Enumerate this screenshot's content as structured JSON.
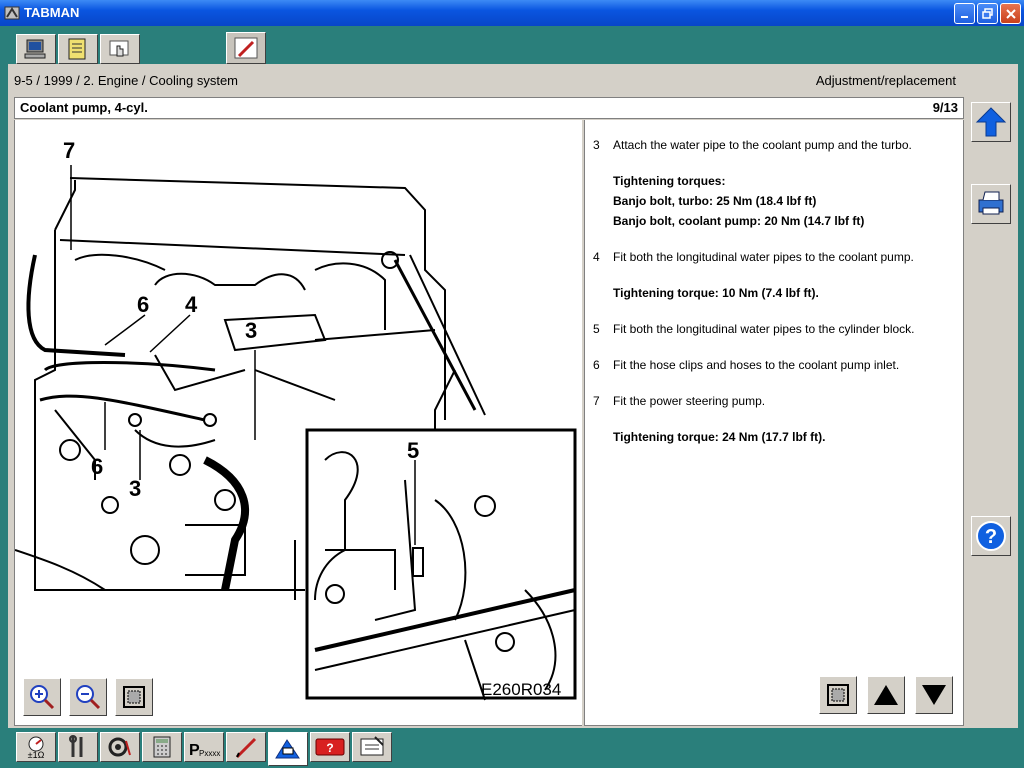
{
  "window": {
    "title": "TABMAN"
  },
  "header": {
    "breadcrumb": "9-5 / 1999 / 2. Engine / Cooling system",
    "section": "Adjustment/replacement",
    "doc_title": "Coolant pump, 4-cyl.",
    "page": "9/13"
  },
  "figure": {
    "code": "E260R034",
    "callouts": [
      "7",
      "6",
      "4",
      "3",
      "6",
      "3",
      "5"
    ]
  },
  "steps": [
    {
      "num": "3",
      "text": "Attach the water pipe to the coolant pump and the turbo."
    },
    {
      "num": "4",
      "text": "Fit both the longitudinal water pipes to the coolant pump."
    },
    {
      "num": "5",
      "text": "Fit both the longitudinal water pipes to the cylinder block."
    },
    {
      "num": "6",
      "text": "Fit the hose clips and hoses to the coolant pump inlet."
    },
    {
      "num": "7",
      "text": "Fit the power steering pump."
    }
  ],
  "torques": {
    "t1_head": "Tightening torques:",
    "t1_a": "Banjo bolt, turbo: 25 Nm (18.4 lbf ft)",
    "t1_b": "Banjo bolt, coolant pump: 20 Nm (14.7 lbf ft)",
    "t2": "Tightening torque: 10 Nm (7.4 lbf ft).",
    "t3": "Tightening torque: 24 Nm (17.7 lbf ft)."
  },
  "bottom": {
    "multimeter_label": "±1Ω",
    "pxxxx_label": "Pxxxx"
  },
  "colors": {
    "teal": "#2a7f7b",
    "titlebar": "#0a55e0",
    "arrow_blue": "#1060e0"
  }
}
